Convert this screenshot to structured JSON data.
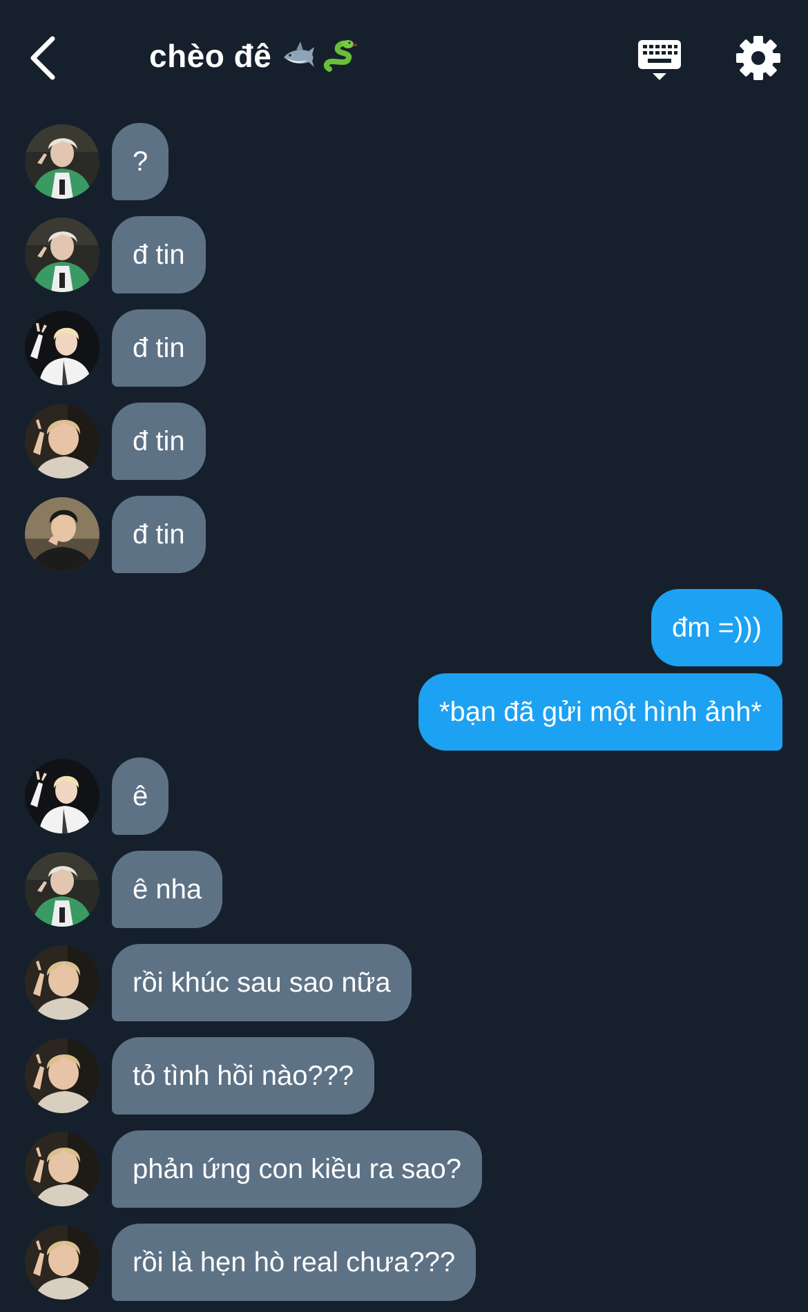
{
  "header": {
    "title": "chèo đê",
    "title_emojis": [
      "shark-icon",
      "snake-icon"
    ],
    "back_icon": "chevron-left-icon",
    "keyboard_icon": "keyboard-icon",
    "settings_icon": "gear-icon"
  },
  "colors": {
    "background": "#16202c",
    "incoming_bubble": "#5e7286",
    "outgoing_bubble": "#1da1f2",
    "text": "#ffffff"
  },
  "messages": [
    {
      "direction": "in",
      "sender_avatar": "avatar-a",
      "text": "?"
    },
    {
      "direction": "in",
      "sender_avatar": "avatar-a",
      "text": "đ tin"
    },
    {
      "direction": "in",
      "sender_avatar": "avatar-b",
      "text": "đ tin"
    },
    {
      "direction": "in",
      "sender_avatar": "avatar-c",
      "text": "đ tin"
    },
    {
      "direction": "in",
      "sender_avatar": "avatar-d",
      "text": "đ tin"
    },
    {
      "direction": "out",
      "text": "đm =)))"
    },
    {
      "direction": "out",
      "text": "*bạn đã gửi một hình ảnh*"
    },
    {
      "direction": "in",
      "sender_avatar": "avatar-b",
      "text": "ê"
    },
    {
      "direction": "in",
      "sender_avatar": "avatar-a",
      "text": "ê nha"
    },
    {
      "direction": "in",
      "sender_avatar": "avatar-c",
      "text": "rồi khúc sau sao nữa"
    },
    {
      "direction": "in",
      "sender_avatar": "avatar-c",
      "text": "tỏ tình hồi nào???"
    },
    {
      "direction": "in",
      "sender_avatar": "avatar-c",
      "text": "phản ứng con kiều ra sao?"
    },
    {
      "direction": "in",
      "sender_avatar": "avatar-c",
      "text": "rồi là hẹn hò real chưa???"
    }
  ]
}
